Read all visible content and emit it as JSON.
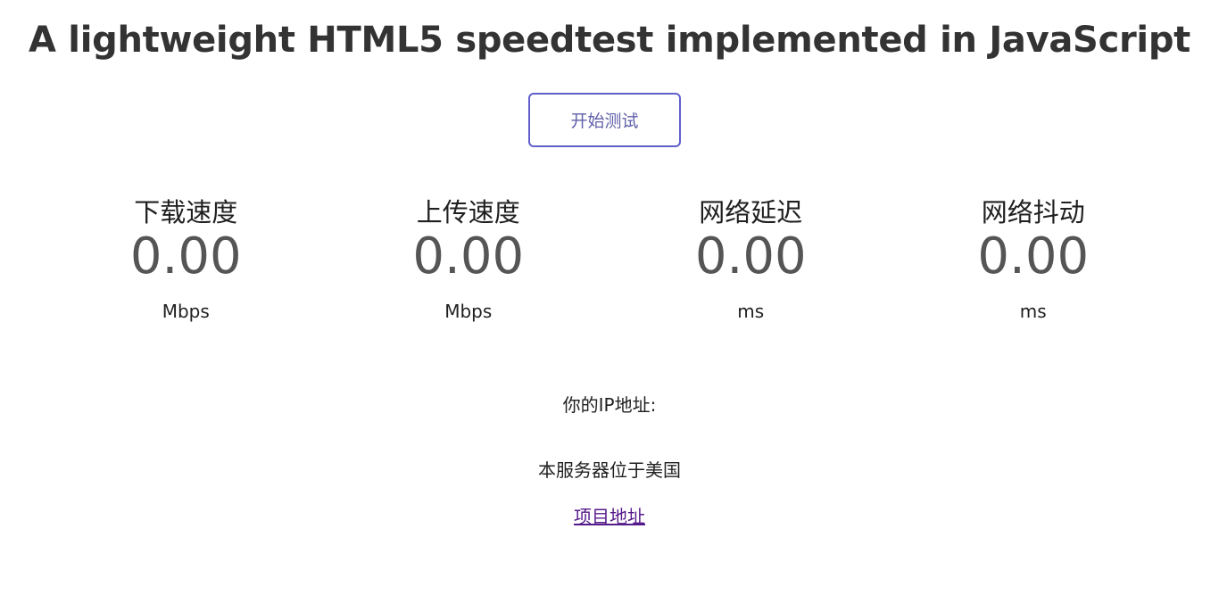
{
  "header": {
    "title": "A lightweight HTML5 speedtest implemented in JavaScript"
  },
  "controls": {
    "start_label": "开始测试",
    "accent_color": "#6060cc"
  },
  "metrics": [
    {
      "title": "下载速度",
      "value": "0.00",
      "unit": "Mbps"
    },
    {
      "title": "上传速度",
      "value": "0.00",
      "unit": "Mbps"
    },
    {
      "title": "网络延迟",
      "value": "0.00",
      "unit": "ms"
    },
    {
      "title": "网络抖动",
      "value": "0.00",
      "unit": "ms"
    }
  ],
  "info": {
    "ip_label": "你的IP地址:",
    "server_location": "本服务器位于美国",
    "project_link": "项目地址"
  }
}
